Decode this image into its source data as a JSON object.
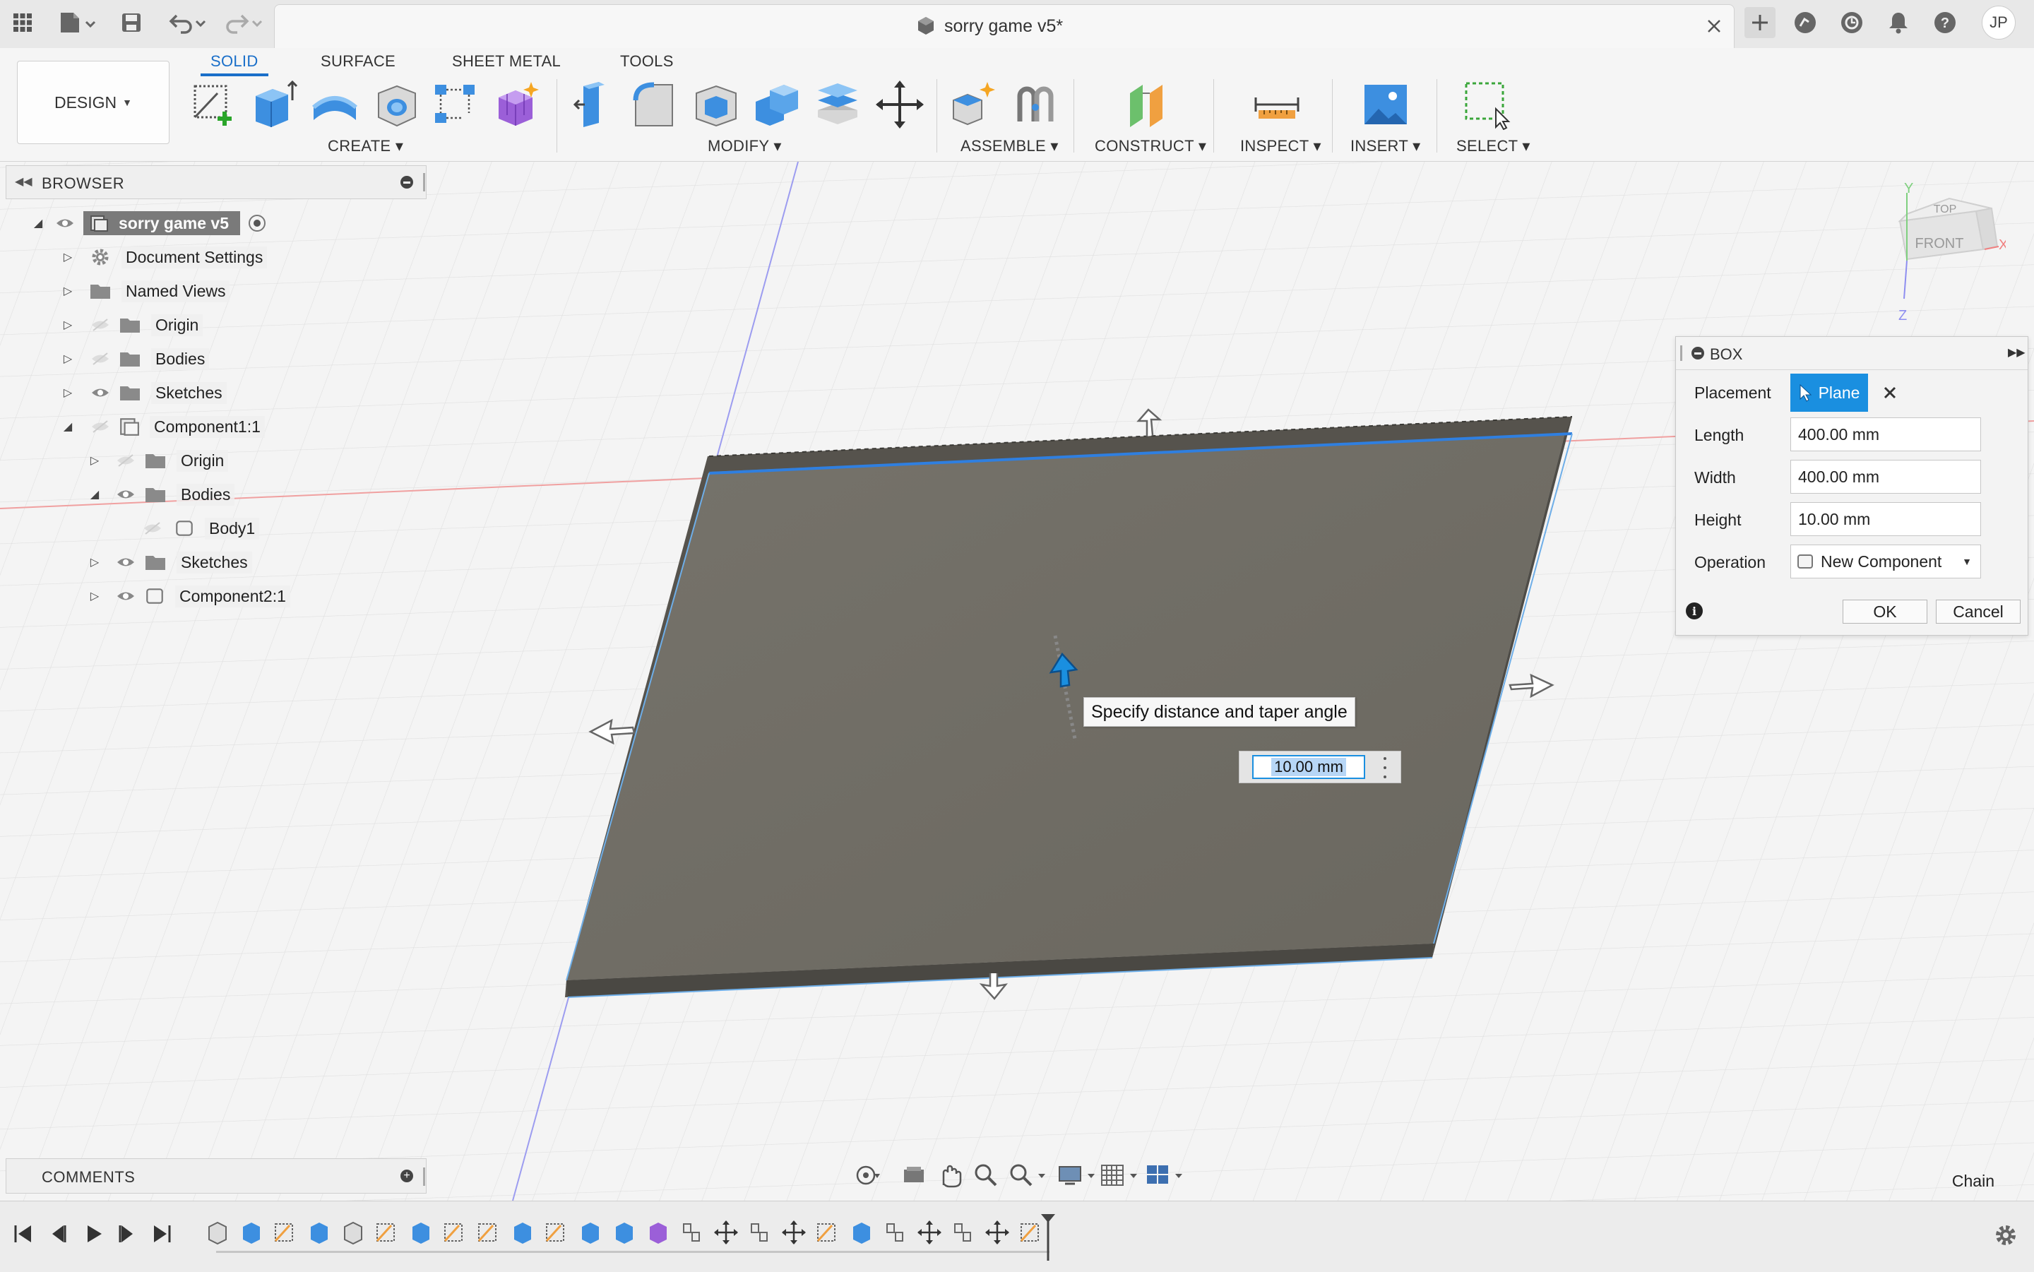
{
  "app": {
    "title": "sorry game v5*",
    "user_initials": "JP"
  },
  "toolbar": {
    "workspace": "DESIGN",
    "tabs": [
      {
        "label": "SOLID",
        "active": true
      },
      {
        "label": "SURFACE",
        "active": false
      },
      {
        "label": "SHEET METAL",
        "active": false
      },
      {
        "label": "TOOLS",
        "active": false
      }
    ],
    "groups": {
      "create": "CREATE",
      "modify": "MODIFY",
      "assemble": "ASSEMBLE",
      "construct": "CONSTRUCT",
      "inspect": "INSPECT",
      "insert": "INSERT",
      "select": "SELECT"
    }
  },
  "browser": {
    "header": "BROWSER",
    "items": [
      {
        "label": "sorry game v5",
        "level": 0,
        "expanded": true,
        "icon": "component-icon"
      },
      {
        "label": "Document Settings",
        "level": 1,
        "expanded": false,
        "icon": "gear-icon"
      },
      {
        "label": "Named Views",
        "level": 1,
        "expanded": false,
        "icon": "folder-icon"
      },
      {
        "label": "Origin",
        "level": 1,
        "expanded": false,
        "icon": "folder-icon"
      },
      {
        "label": "Bodies",
        "level": 1,
        "expanded": false,
        "icon": "folder-icon"
      },
      {
        "label": "Sketches",
        "level": 1,
        "expanded": false,
        "icon": "folder-icon"
      },
      {
        "label": "Component1:1",
        "level": 1,
        "expanded": true,
        "icon": "component-icon"
      },
      {
        "label": "Origin",
        "level": 2,
        "expanded": false,
        "icon": "folder-icon"
      },
      {
        "label": "Bodies",
        "level": 2,
        "expanded": true,
        "icon": "folder-icon"
      },
      {
        "label": "Body1",
        "level": 3,
        "expanded": false,
        "icon": "body-icon"
      },
      {
        "label": "Sketches",
        "level": 2,
        "expanded": false,
        "icon": "folder-icon"
      },
      {
        "label": "Component2:1",
        "level": 2,
        "expanded": false,
        "icon": "component-icon"
      }
    ]
  },
  "viewcube": {
    "top": "TOP",
    "front": "FRONT",
    "x": "X",
    "y": "Y",
    "z": "Z"
  },
  "viewport": {
    "tooltip": "Specify distance and taper angle",
    "distance_value": "10.00 mm",
    "status_right": "Chain"
  },
  "box_dialog": {
    "title": "BOX",
    "placement_label": "Placement",
    "placement_value": "Plane",
    "length_label": "Length",
    "length_value": "400.00 mm",
    "width_label": "Width",
    "width_value": "400.00 mm",
    "height_label": "Height",
    "height_value": "10.00 mm",
    "operation_label": "Operation",
    "operation_value": "New Component",
    "ok_label": "OK",
    "cancel_label": "Cancel"
  },
  "comments": {
    "header": "COMMENTS"
  },
  "colors": {
    "accent": "#1a8fe0",
    "active_tab": "#1a6fc9",
    "body_fill": "#6e6b63",
    "edge_highlight": "#2f7fe0"
  }
}
